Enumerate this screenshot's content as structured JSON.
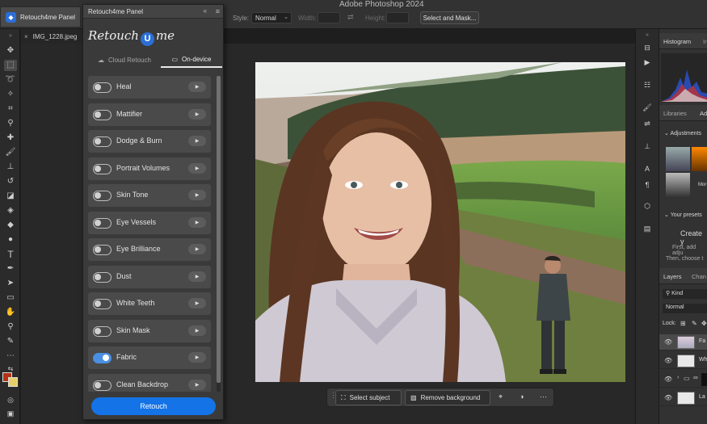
{
  "app": {
    "title": "Adobe Photoshop 2024"
  },
  "topbar": {
    "panel_tab": "Retouch4me Panel",
    "style_label": "Style:",
    "style_value": "Normal",
    "width_label": "Width:",
    "height_label": "Height:",
    "select_mask": "Select and Mask..."
  },
  "document": {
    "tab": "IMG_1228.jpeg"
  },
  "retouch_panel": {
    "title": "Retouch4me Panel",
    "logo_left": "Retouch",
    "logo_u": "U",
    "logo_right": "me",
    "tabs": [
      {
        "label": "Cloud Retouch",
        "icon": "cloud-icon",
        "active": false
      },
      {
        "label": "On-device",
        "icon": "monitor-icon",
        "active": true
      }
    ],
    "items": [
      {
        "label": "Heal",
        "on": false
      },
      {
        "label": "Mattifier",
        "on": false
      },
      {
        "label": "Dodge & Burn",
        "on": false
      },
      {
        "label": "Portrait Volumes",
        "on": false
      },
      {
        "label": "Skin Tone",
        "on": false
      },
      {
        "label": "Eye Vessels",
        "on": false
      },
      {
        "label": "Eye Brilliance",
        "on": false
      },
      {
        "label": "Dust",
        "on": false
      },
      {
        "label": "White Teeth",
        "on": false
      },
      {
        "label": "Skin Mask",
        "on": false
      },
      {
        "label": "Fabric",
        "on": true
      },
      {
        "label": "Clean Backdrop",
        "on": false
      }
    ],
    "retouch_button": "Retouch"
  },
  "taskbar": {
    "select_subject": "Select subject",
    "remove_background": "Remove background"
  },
  "right_panel": {
    "histogram_tab": "Histogram",
    "info_tab": "In",
    "libraries_tab": "Libraries",
    "adjust_tab": "Ad",
    "adjustments_header": "Adjustments",
    "more_label": "Mor",
    "presets_header": "Your presets",
    "create_text": "Create y",
    "first_text": "First, add adju",
    "then_text": "Then, choose t",
    "layers_tab": "Layers",
    "channels_tab": "Chan",
    "kind_label": "Kind",
    "blend_mode": "Normal",
    "lock_label": "Lock:",
    "layers": [
      {
        "name": "Fa"
      },
      {
        "name": "Wh"
      },
      {
        "name": ""
      },
      {
        "name": "La"
      }
    ]
  },
  "colors": {
    "accent": "#1473e6",
    "toggle_on": "#4a90e2",
    "foreground_color": "#b33217",
    "background_color": "#e6cf6a"
  }
}
